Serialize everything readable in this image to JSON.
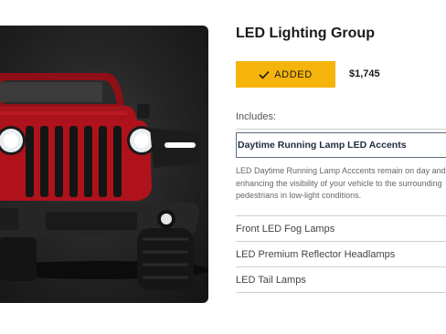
{
  "product": {
    "title": "LED Lighting Group",
    "added_label": "ADDED",
    "price": "$1,745",
    "includes_label": "Includes:"
  },
  "colors": {
    "accent": "#f5b40c",
    "active_border": "#5b6b82",
    "vehicle_red": "#b0121c"
  },
  "accordion": {
    "active": {
      "label": "Daytime Running Lamp LED Accents",
      "description": [
        "LED Daytime Running Lamp Acccents remain on day and",
        "enhancing the visibility of your vehicle to the surrounding",
        "pedestrians in low-light conditions."
      ]
    },
    "items": [
      {
        "label": "Front LED Fog Lamps"
      },
      {
        "label": "LED Premium Reflector Headlamps"
      },
      {
        "label": "LED Tail Lamps"
      }
    ]
  },
  "icons": {
    "check": "check-icon"
  }
}
